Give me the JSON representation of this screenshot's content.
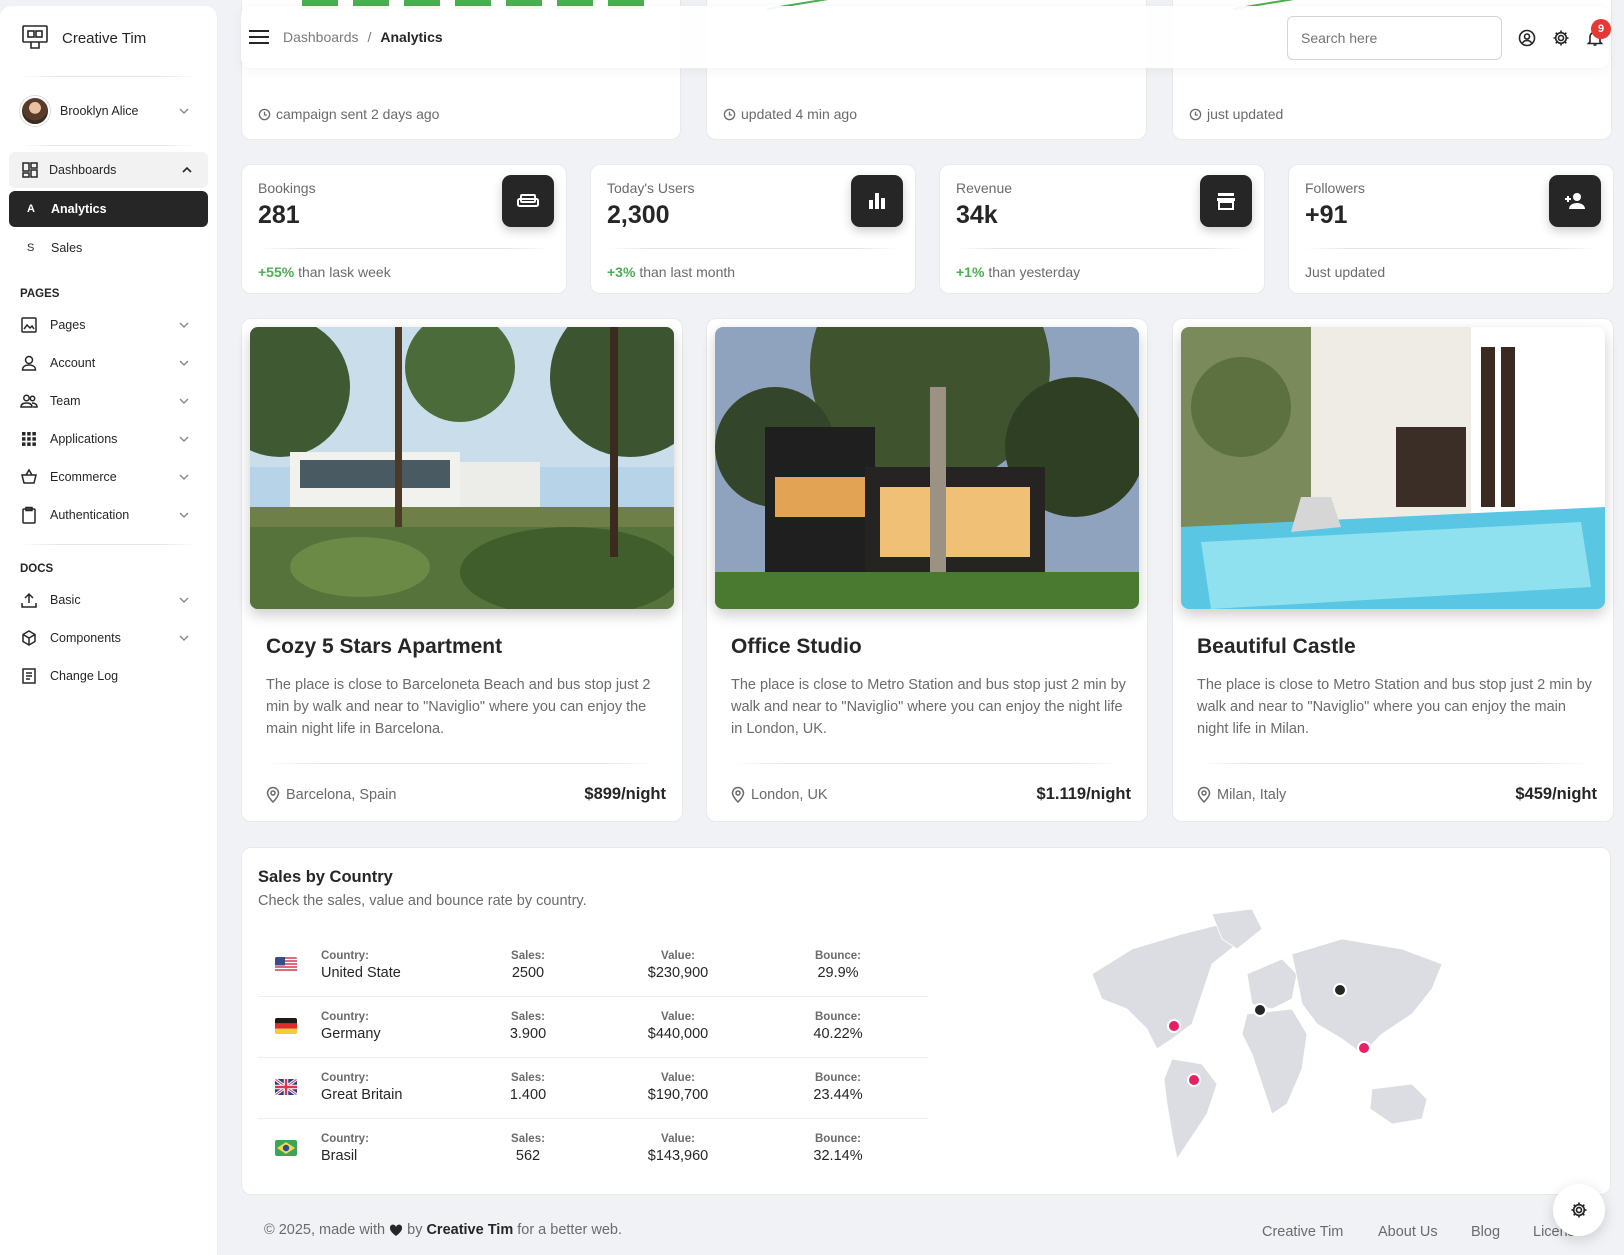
{
  "sidebar": {
    "brand": "Creative Tim",
    "user_name": "Brooklyn Alice",
    "dashboards_label": "Dashboards",
    "dash_items": [
      {
        "abbr": "A",
        "label": "Analytics"
      },
      {
        "abbr": "S",
        "label": "Sales"
      }
    ],
    "pages_title": "PAGES",
    "pages": [
      {
        "label": "Pages",
        "icon": "image-icon"
      },
      {
        "label": "Account",
        "icon": "user-icon"
      },
      {
        "label": "Team",
        "icon": "team-icon"
      },
      {
        "label": "Applications",
        "icon": "apps-icon"
      },
      {
        "label": "Ecommerce",
        "icon": "basket-icon"
      },
      {
        "label": "Authentication",
        "icon": "clipboard-icon"
      }
    ],
    "docs_title": "DOCS",
    "docs": [
      {
        "label": "Basic",
        "icon": "upload-icon"
      },
      {
        "label": "Components",
        "icon": "components-icon"
      },
      {
        "label": "Change Log",
        "icon": "receipt-icon"
      }
    ]
  },
  "navbar": {
    "breadcrumb_parent": "Dashboards",
    "breadcrumb_sep": "/",
    "breadcrumb_current": "Analytics",
    "search_placeholder": "Search here",
    "notification_count": "9"
  },
  "top_cards": [
    {
      "footer": "campaign sent 2 days ago"
    },
    {
      "footer": "updated 4 min ago"
    },
    {
      "footer": "just updated"
    }
  ],
  "stats": [
    {
      "label": "Bookings",
      "value": "281",
      "change": "+55%",
      "note": "than lask week",
      "icon": "sofa-icon"
    },
    {
      "label": "Today's Users",
      "value": "2,300",
      "change": "+3%",
      "note": "than last month",
      "icon": "chart-icon"
    },
    {
      "label": "Revenue",
      "value": "34k",
      "change": "+1%",
      "note": "than yesterday",
      "icon": "store-icon"
    },
    {
      "label": "Followers",
      "value": "+91",
      "change": "",
      "note": "Just updated",
      "icon": "person-add-icon"
    }
  ],
  "properties": [
    {
      "title": "Cozy 5 Stars Apartment",
      "desc": "The place is close to Barceloneta Beach and bus stop just 2 min by walk and near to \"Naviglio\" where you can enjoy the main night life in Barcelona.",
      "location": "Barcelona, Spain",
      "price": "$899/night"
    },
    {
      "title": "Office Studio",
      "desc": "The place is close to Metro Station and bus stop just 2 min by walk and near to \"Naviglio\" where you can enjoy the night life in London, UK.",
      "location": "London, UK",
      "price": "$1.119/night"
    },
    {
      "title": "Beautiful Castle",
      "desc": "The place is close to Metro Station and bus stop just 2 min by walk and near to \"Naviglio\" where you can enjoy the main night life in Milan.",
      "location": "Milan, Italy",
      "price": "$459/night"
    }
  ],
  "sales": {
    "title": "Sales by Country",
    "subtitle": "Check the sales, value and bounce rate by country.",
    "col_country": "Country:",
    "col_sales": "Sales:",
    "col_value": "Value:",
    "col_bounce": "Bounce:",
    "rows": [
      {
        "country": "United State",
        "sales": "2500",
        "value": "$230,900",
        "bounce": "29.9%"
      },
      {
        "country": "Germany",
        "sales": "3.900",
        "value": "$440,000",
        "bounce": "40.22%"
      },
      {
        "country": "Great Britain",
        "sales": "1.400",
        "value": "$190,700",
        "bounce": "23.44%"
      },
      {
        "country": "Brasil",
        "sales": "562",
        "value": "$143,960",
        "bounce": "32.14%"
      }
    ]
  },
  "footer": {
    "copyright": "© 2025, made with",
    "by": "by",
    "author": "Creative Tim",
    "tail": "for a better web.",
    "links": [
      "Creative Tim",
      "About Us",
      "Blog",
      "License"
    ]
  },
  "colors": {
    "accent": "#262626",
    "positive": "#4caf50",
    "badge": "#e53935",
    "map_marker": "#e91e63"
  }
}
